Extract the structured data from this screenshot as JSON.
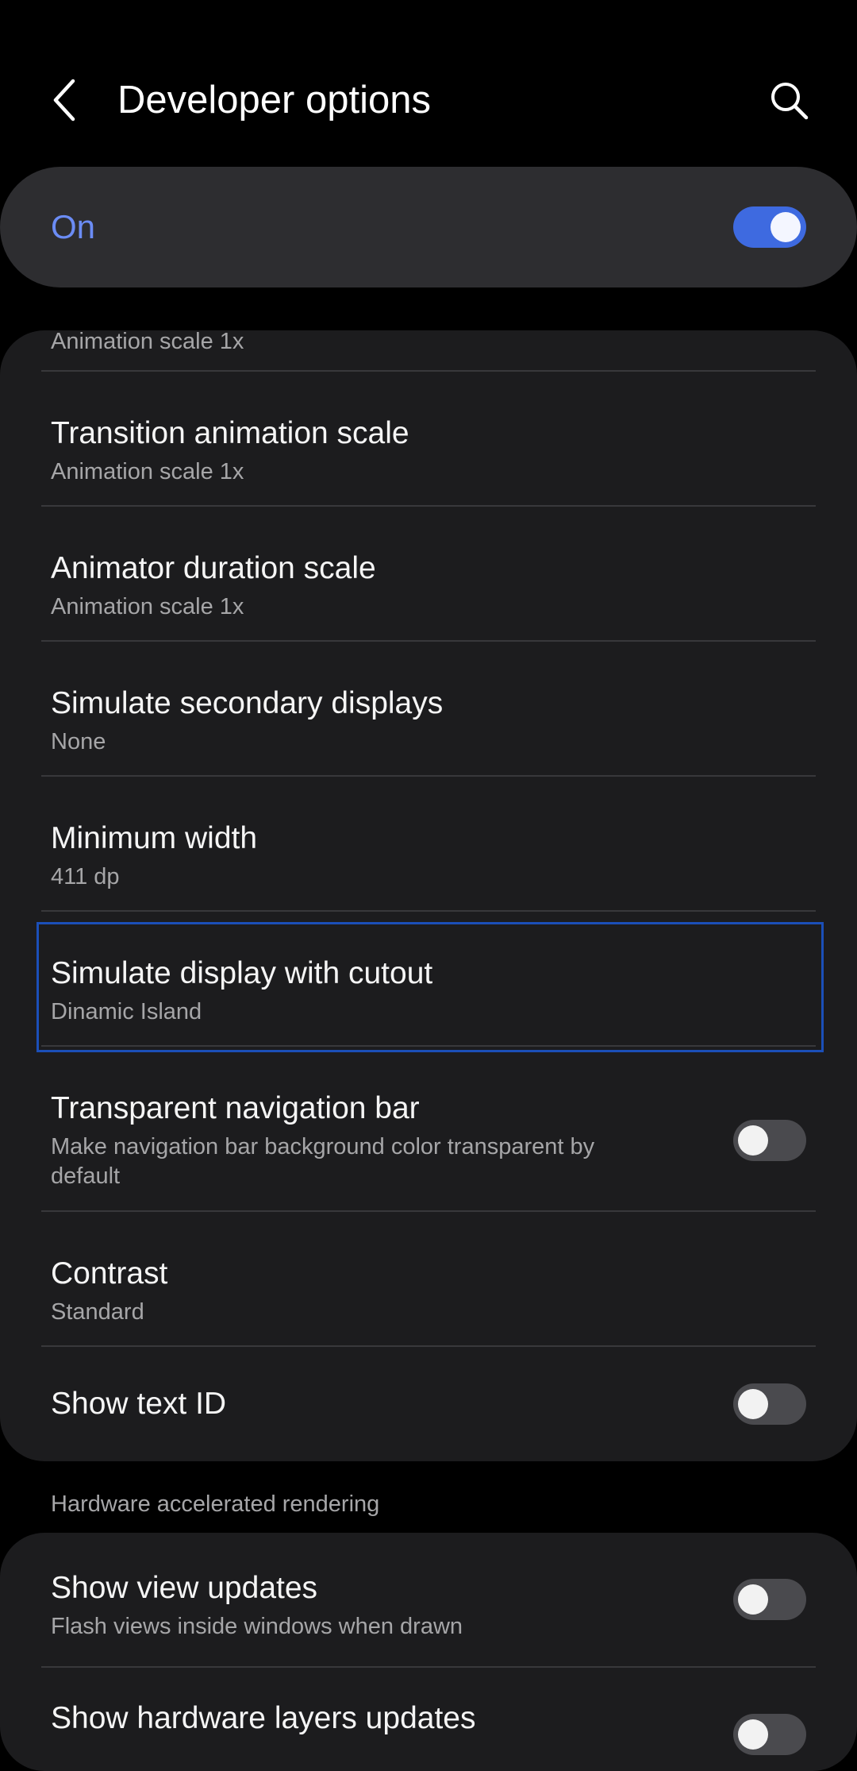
{
  "header": {
    "title": "Developer options",
    "back_icon": "chevron-left-icon",
    "search_icon": "search-icon"
  },
  "master": {
    "label": "On",
    "enabled": true,
    "accent_color": "#6b8cf5"
  },
  "items": [
    {
      "title": "",
      "subtitle": "Animation scale 1x"
    },
    {
      "title": "Transition animation scale",
      "subtitle": "Animation scale 1x"
    },
    {
      "title": "Animator duration scale",
      "subtitle": "Animation scale 1x"
    },
    {
      "title": "Simulate secondary displays",
      "subtitle": "None"
    },
    {
      "title": "Minimum width",
      "subtitle": "411 dp"
    },
    {
      "title": "Simulate display with cutout",
      "subtitle": "Dinamic Island"
    },
    {
      "title": "Transparent navigation bar",
      "subtitle": "Make navigation bar background color transparent by default",
      "toggle": false
    },
    {
      "title": "Contrast",
      "subtitle": "Standard"
    },
    {
      "title": "Show text ID",
      "toggle": false
    }
  ],
  "section": {
    "title": "Hardware accelerated rendering"
  },
  "items2": [
    {
      "title": "Show view updates",
      "subtitle": "Flash views inside windows when drawn",
      "toggle": false
    },
    {
      "title": "Show hardware layers updates",
      "toggle": false
    }
  ]
}
